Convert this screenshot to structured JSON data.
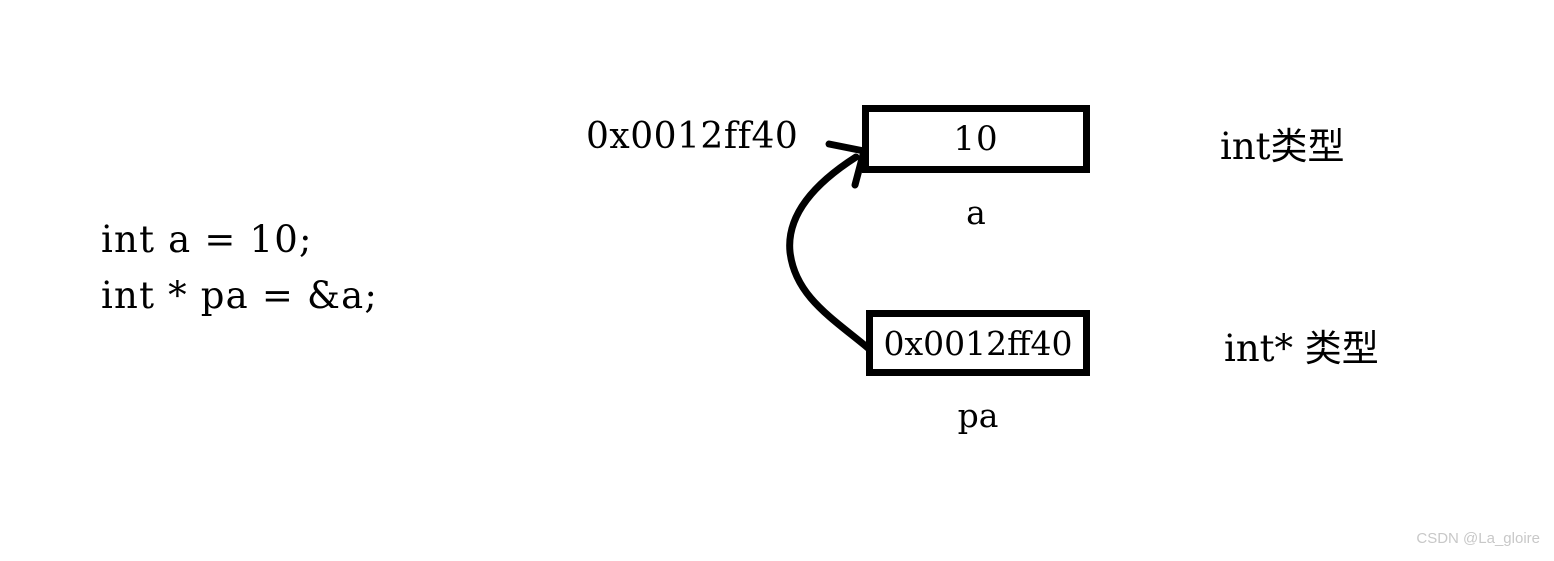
{
  "diagram": {
    "title": "pointer-memory-diagram",
    "code": {
      "lines": [
        "int a = 10;",
        "int * pa = &a;"
      ]
    },
    "address_annotation": "0x0012ff40",
    "boxes": [
      {
        "id": "a",
        "value": "10",
        "name_label": "a",
        "type_label": "int类型"
      },
      {
        "id": "pa",
        "value": "0x0012ff40",
        "name_label": "pa",
        "type_label": "int* 类型"
      }
    ],
    "arrow": {
      "name": "pointer-arrow",
      "from": "pa-box-left-edge",
      "to": "a-box-left-edge",
      "color": "#000000",
      "stroke_width": 7
    },
    "watermark": "CSDN @La_gloire",
    "colors": {
      "background": "#ffffff",
      "ink": "#000000",
      "watermark": "#c8c8c8"
    }
  }
}
